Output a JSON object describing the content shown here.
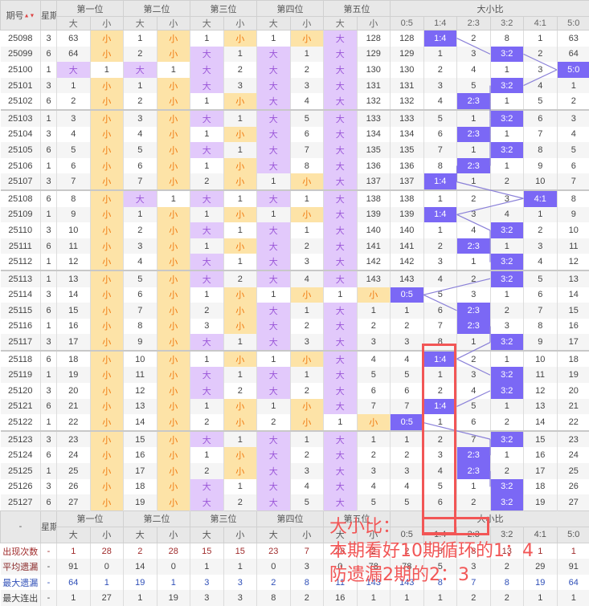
{
  "header": {
    "issue": "期号",
    "weekday": "星期",
    "positions": [
      "第一位",
      "第二位",
      "第三位",
      "第四位",
      "第五位"
    ],
    "big": "大",
    "small": "小",
    "ratio_group": "大小比",
    "ratios": [
      "0:5",
      "1:4",
      "2:3",
      "3:2",
      "4:1",
      "5:0"
    ]
  },
  "rows": [
    {
      "id": "25098",
      "w": "3",
      "c": [
        "63",
        "小",
        "1",
        "小",
        "1",
        "小",
        "1",
        "小",
        "大",
        "128"
      ],
      "r": [
        "128",
        "1:4",
        "2",
        "8",
        "1",
        "63"
      ]
    },
    {
      "id": "25099",
      "w": "6",
      "c": [
        "64",
        "小",
        "2",
        "小",
        "大",
        "1",
        "大",
        "1",
        "大",
        "129"
      ],
      "r": [
        "129",
        "1",
        "3",
        "3:2",
        "2",
        "64"
      ]
    },
    {
      "id": "25100",
      "w": "1",
      "c": [
        "大",
        "1",
        "大",
        "1",
        "大",
        "2",
        "大",
        "2",
        "大",
        "130"
      ],
      "r": [
        "130",
        "2",
        "4",
        "1",
        "3",
        "5:0"
      ]
    },
    {
      "id": "25101",
      "w": "3",
      "c": [
        "1",
        "小",
        "1",
        "小",
        "大",
        "3",
        "大",
        "3",
        "大",
        "131"
      ],
      "r": [
        "131",
        "3",
        "5",
        "3:2",
        "4",
        "1"
      ]
    },
    {
      "id": "25102",
      "w": "6",
      "c": [
        "2",
        "小",
        "2",
        "小",
        "1",
        "小",
        "大",
        "4",
        "大",
        "132"
      ],
      "r": [
        "132",
        "4",
        "2:3",
        "1",
        "5",
        "2"
      ]
    },
    {
      "id": "25103",
      "w": "1",
      "c": [
        "3",
        "小",
        "3",
        "小",
        "大",
        "1",
        "大",
        "5",
        "大",
        "133"
      ],
      "r": [
        "133",
        "5",
        "1",
        "3:2",
        "6",
        "3"
      ]
    },
    {
      "id": "25104",
      "w": "3",
      "c": [
        "4",
        "小",
        "4",
        "小",
        "1",
        "小",
        "大",
        "6",
        "大",
        "134"
      ],
      "r": [
        "134",
        "6",
        "2:3",
        "1",
        "7",
        "4"
      ]
    },
    {
      "id": "25105",
      "w": "6",
      "c": [
        "5",
        "小",
        "5",
        "小",
        "大",
        "1",
        "大",
        "7",
        "大",
        "135"
      ],
      "r": [
        "135",
        "7",
        "1",
        "3:2",
        "8",
        "5"
      ]
    },
    {
      "id": "25106",
      "w": "1",
      "c": [
        "6",
        "小",
        "6",
        "小",
        "1",
        "小",
        "大",
        "8",
        "大",
        "136"
      ],
      "r": [
        "136",
        "8",
        "2:3",
        "1",
        "9",
        "6"
      ]
    },
    {
      "id": "25107",
      "w": "3",
      "c": [
        "7",
        "小",
        "7",
        "小",
        "2",
        "小",
        "1",
        "小",
        "大",
        "137"
      ],
      "r": [
        "137",
        "1:4",
        "1",
        "2",
        "10",
        "7"
      ]
    },
    {
      "id": "25108",
      "w": "6",
      "c": [
        "8",
        "小",
        "大",
        "1",
        "大",
        "1",
        "大",
        "1",
        "大",
        "138"
      ],
      "r": [
        "138",
        "1",
        "2",
        "3",
        "4:1",
        "8"
      ]
    },
    {
      "id": "25109",
      "w": "1",
      "c": [
        "9",
        "小",
        "1",
        "小",
        "1",
        "小",
        "1",
        "小",
        "大",
        "139"
      ],
      "r": [
        "139",
        "1:4",
        "3",
        "4",
        "1",
        "9"
      ]
    },
    {
      "id": "25110",
      "w": "3",
      "c": [
        "10",
        "小",
        "2",
        "小",
        "大",
        "1",
        "大",
        "1",
        "大",
        "140"
      ],
      "r": [
        "140",
        "1",
        "4",
        "3:2",
        "2",
        "10"
      ]
    },
    {
      "id": "25111",
      "w": "6",
      "c": [
        "11",
        "小",
        "3",
        "小",
        "1",
        "小",
        "大",
        "2",
        "大",
        "141"
      ],
      "r": [
        "141",
        "2",
        "2:3",
        "1",
        "3",
        "11"
      ]
    },
    {
      "id": "25112",
      "w": "1",
      "c": [
        "12",
        "小",
        "4",
        "小",
        "大",
        "1",
        "大",
        "3",
        "大",
        "142"
      ],
      "r": [
        "142",
        "3",
        "1",
        "3:2",
        "4",
        "12"
      ]
    },
    {
      "id": "25113",
      "w": "1",
      "c": [
        "13",
        "小",
        "5",
        "小",
        "大",
        "2",
        "大",
        "4",
        "大",
        "143"
      ],
      "r": [
        "143",
        "4",
        "2",
        "3:2",
        "5",
        "13"
      ]
    },
    {
      "id": "25114",
      "w": "3",
      "c": [
        "14",
        "小",
        "6",
        "小",
        "1",
        "小",
        "1",
        "小",
        "1",
        "小"
      ],
      "r": [
        "0:5",
        "5",
        "3",
        "1",
        "6",
        "14"
      ]
    },
    {
      "id": "25115",
      "w": "6",
      "c": [
        "15",
        "小",
        "7",
        "小",
        "2",
        "小",
        "大",
        "1",
        "大",
        "1"
      ],
      "r": [
        "1",
        "6",
        "2:3",
        "2",
        "7",
        "15"
      ]
    },
    {
      "id": "25116",
      "w": "1",
      "c": [
        "16",
        "小",
        "8",
        "小",
        "3",
        "小",
        "大",
        "2",
        "大",
        "2"
      ],
      "r": [
        "2",
        "7",
        "2:3",
        "3",
        "8",
        "16"
      ]
    },
    {
      "id": "25117",
      "w": "3",
      "c": [
        "17",
        "小",
        "9",
        "小",
        "大",
        "1",
        "大",
        "3",
        "大",
        "3"
      ],
      "r": [
        "3",
        "8",
        "1",
        "3:2",
        "9",
        "17"
      ]
    },
    {
      "id": "25118",
      "w": "6",
      "c": [
        "18",
        "小",
        "10",
        "小",
        "1",
        "小",
        "1",
        "小",
        "大",
        "4"
      ],
      "r": [
        "4",
        "1:4",
        "2",
        "1",
        "10",
        "18"
      ]
    },
    {
      "id": "25119",
      "w": "1",
      "c": [
        "19",
        "小",
        "11",
        "小",
        "大",
        "1",
        "大",
        "1",
        "大",
        "5"
      ],
      "r": [
        "5",
        "1",
        "3",
        "3:2",
        "11",
        "19"
      ]
    },
    {
      "id": "25120",
      "w": "3",
      "c": [
        "20",
        "小",
        "12",
        "小",
        "大",
        "2",
        "大",
        "2",
        "大",
        "6"
      ],
      "r": [
        "6",
        "2",
        "4",
        "3:2",
        "12",
        "20"
      ]
    },
    {
      "id": "25121",
      "w": "6",
      "c": [
        "21",
        "小",
        "13",
        "小",
        "1",
        "小",
        "1",
        "小",
        "大",
        "7"
      ],
      "r": [
        "7",
        "1:4",
        "5",
        "1",
        "13",
        "21"
      ]
    },
    {
      "id": "25122",
      "w": "1",
      "c": [
        "22",
        "小",
        "14",
        "小",
        "2",
        "小",
        "2",
        "小",
        "1",
        "小"
      ],
      "r": [
        "0:5",
        "1",
        "6",
        "2",
        "14",
        "22"
      ]
    },
    {
      "id": "25123",
      "w": "3",
      "c": [
        "23",
        "小",
        "15",
        "小",
        "大",
        "1",
        "大",
        "1",
        "大",
        "1"
      ],
      "r": [
        "1",
        "2",
        "7",
        "3:2",
        "15",
        "23"
      ]
    },
    {
      "id": "25124",
      "w": "6",
      "c": [
        "24",
        "小",
        "16",
        "小",
        "1",
        "小",
        "大",
        "2",
        "大",
        "2"
      ],
      "r": [
        "2",
        "3",
        "2:3",
        "1",
        "16",
        "24"
      ]
    },
    {
      "id": "25125",
      "w": "1",
      "c": [
        "25",
        "小",
        "17",
        "小",
        "2",
        "小",
        "大",
        "3",
        "大",
        "3"
      ],
      "r": [
        "3",
        "4",
        "2:3",
        "2",
        "17",
        "25"
      ]
    },
    {
      "id": "25126",
      "w": "3",
      "c": [
        "26",
        "小",
        "18",
        "小",
        "大",
        "1",
        "大",
        "4",
        "大",
        "4"
      ],
      "r": [
        "4",
        "5",
        "1",
        "3:2",
        "18",
        "26"
      ]
    },
    {
      "id": "25127",
      "w": "6",
      "c": [
        "27",
        "小",
        "19",
        "小",
        "大",
        "2",
        "大",
        "5",
        "大",
        "5"
      ],
      "r": [
        "5",
        "6",
        "2",
        "3:2",
        "19",
        "27"
      ]
    }
  ],
  "footer": {
    "corner": "-",
    "weekday": "星期",
    "rows": [
      {
        "label": "出现次数",
        "w": "-",
        "v": [
          "1",
          "28",
          "2",
          "28",
          "15",
          "15",
          "23",
          "7",
          "28",
          "2",
          "2",
          "5",
          "8",
          "13",
          "1",
          "1"
        ]
      },
      {
        "label": "平均遗漏",
        "w": "-",
        "v": [
          "91",
          "0",
          "14",
          "0",
          "1",
          "1",
          "0",
          "3",
          "0",
          "78",
          "78",
          "5",
          "3",
          "2",
          "29",
          "91"
        ]
      },
      {
        "label": "最大遗漏",
        "w": "-",
        "v": [
          "64",
          "1",
          "19",
          "1",
          "3",
          "3",
          "2",
          "8",
          "11",
          "143",
          "143",
          "8",
          "7",
          "8",
          "19",
          "64"
        ]
      },
      {
        "label": "最大连出",
        "w": "-",
        "v": [
          "1",
          "27",
          "1",
          "19",
          "3",
          "3",
          "8",
          "2",
          "16",
          "1",
          "1",
          "1",
          "2",
          "2",
          "1",
          "1"
        ]
      }
    ]
  },
  "annotation": {
    "line1": "大小比：",
    "line2": "本期看好10期循环的1：4",
    "line3": "防遗漏2期的2：3"
  },
  "colors": {
    "big_bg": "#e2c9fb",
    "small_bg": "#fde3a7",
    "hit_bg": "#7b68f5",
    "trend": "#8a80d8",
    "annotation": "#f25656"
  }
}
